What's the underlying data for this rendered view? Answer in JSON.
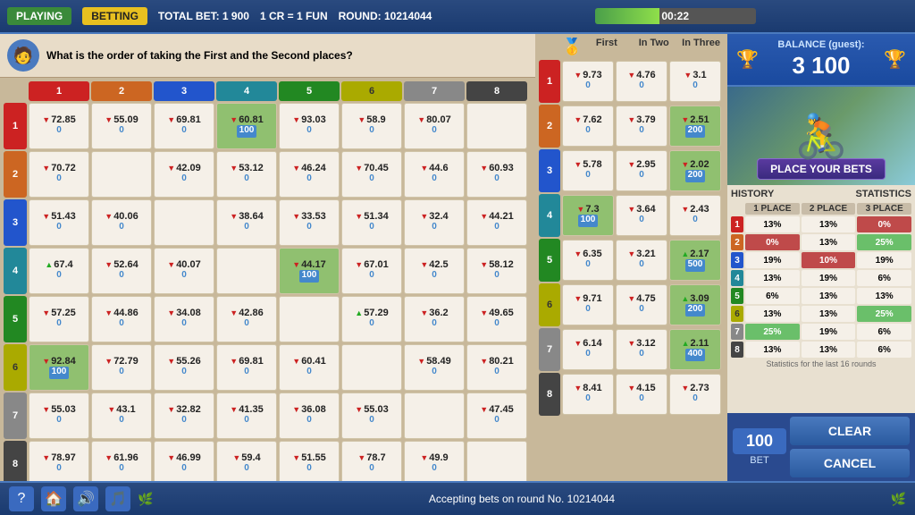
{
  "topBar": {
    "playing": "PLAYING",
    "betting": "BETTING",
    "totalBet": "TOTAL BET:  1 900",
    "crInfo": "1 CR = 1 FUN",
    "round": "ROUND:  10214044",
    "timer": "00:22",
    "timerPercent": 40
  },
  "balance": {
    "title": "BALANCE (guest):",
    "amount": "3 100"
  },
  "placeBets": "PLACE YOUR BETS",
  "question": "What is the order of taking the First and the Second places?",
  "colHeaders": [
    "1",
    "2",
    "3",
    "4",
    "5",
    "6",
    "7",
    "8"
  ],
  "rowHeaders": [
    "1",
    "2",
    "3",
    "4",
    "5",
    "6",
    "7",
    "8"
  ],
  "oddsHeaders": {
    "first": "First",
    "inTwo": "In Two",
    "inThree": "In Three"
  },
  "gridData": [
    [
      {
        "odds": "72.85",
        "bet": "0",
        "up": false
      },
      {
        "odds": "55.09",
        "bet": "0",
        "up": false
      },
      {
        "odds": "69.81",
        "bet": "0",
        "up": false
      },
      {
        "odds": "60.81",
        "bet": "100",
        "up": false,
        "hl": true
      },
      {
        "odds": "93.03",
        "bet": "0",
        "up": false
      },
      {
        "odds": "58.9",
        "bet": "0",
        "up": false
      },
      {
        "odds": "80.07",
        "bet": "0",
        "up": false
      },
      {
        "odds": "",
        "bet": "",
        "skip": true
      }
    ],
    [
      {
        "odds": "70.72",
        "bet": "0",
        "up": false
      },
      {
        "odds": "",
        "bet": "",
        "skip": true
      },
      {
        "odds": "42.09",
        "bet": "0",
        "up": false
      },
      {
        "odds": "53.12",
        "bet": "0",
        "up": false
      },
      {
        "odds": "46.24",
        "bet": "0",
        "up": false
      },
      {
        "odds": "70.45",
        "bet": "0",
        "up": false
      },
      {
        "odds": "44.6",
        "bet": "0",
        "up": false
      },
      {
        "odds": "60.93",
        "bet": "0",
        "up": false
      }
    ],
    [
      {
        "odds": "51.43",
        "bet": "0",
        "up": false
      },
      {
        "odds": "40.06",
        "bet": "0",
        "up": false
      },
      {
        "odds": "",
        "bet": "",
        "skip": true
      },
      {
        "odds": "38.64",
        "bet": "0",
        "up": false
      },
      {
        "odds": "33.53",
        "bet": "0",
        "up": false
      },
      {
        "odds": "51.34",
        "bet": "0",
        "up": false
      },
      {
        "odds": "32.4",
        "bet": "0",
        "up": false
      },
      {
        "odds": "44.21",
        "bet": "0",
        "up": false
      }
    ],
    [
      {
        "odds": "67.4",
        "bet": "0",
        "up": true
      },
      {
        "odds": "52.64",
        "bet": "0",
        "up": false
      },
      {
        "odds": "40.07",
        "bet": "0",
        "up": false
      },
      {
        "odds": "",
        "bet": "",
        "skip": true
      },
      {
        "odds": "44.17",
        "bet": "100",
        "up": false,
        "hl": true
      },
      {
        "odds": "67.01",
        "bet": "0",
        "up": false
      },
      {
        "odds": "42.5",
        "bet": "0",
        "up": false
      },
      {
        "odds": "58.12",
        "bet": "0",
        "up": false
      }
    ],
    [
      {
        "odds": "57.25",
        "bet": "0",
        "up": false
      },
      {
        "odds": "44.86",
        "bet": "0",
        "up": false
      },
      {
        "odds": "34.08",
        "bet": "0",
        "up": false
      },
      {
        "odds": "42.86",
        "bet": "0",
        "up": false
      },
      {
        "odds": "",
        "bet": "",
        "skip": true
      },
      {
        "odds": "57.29",
        "bet": "0",
        "up": true
      },
      {
        "odds": "36.2",
        "bet": "0",
        "up": false
      },
      {
        "odds": "49.65",
        "bet": "0",
        "up": false
      }
    ],
    [
      {
        "odds": "92.84",
        "bet": "100",
        "up": false,
        "hl": true
      },
      {
        "odds": "72.79",
        "bet": "0",
        "up": false
      },
      {
        "odds": "55.26",
        "bet": "0",
        "up": false
      },
      {
        "odds": "69.81",
        "bet": "0",
        "up": false
      },
      {
        "odds": "60.41",
        "bet": "0",
        "up": false
      },
      {
        "odds": "",
        "bet": "",
        "skip": true
      },
      {
        "odds": "58.49",
        "bet": "0",
        "up": false
      },
      {
        "odds": "80.21",
        "bet": "0",
        "up": false
      }
    ],
    [
      {
        "odds": "55.03",
        "bet": "0",
        "up": false
      },
      {
        "odds": "43.1",
        "bet": "0",
        "up": false
      },
      {
        "odds": "32.82",
        "bet": "0",
        "up": false
      },
      {
        "odds": "41.35",
        "bet": "0",
        "up": false
      },
      {
        "odds": "36.08",
        "bet": "0",
        "up": false
      },
      {
        "odds": "55.03",
        "bet": "0",
        "up": false
      },
      {
        "odds": "",
        "bet": "",
        "skip": true
      },
      {
        "odds": "47.45",
        "bet": "0",
        "up": false
      }
    ],
    [
      {
        "odds": "78.97",
        "bet": "0",
        "up": false
      },
      {
        "odds": "61.96",
        "bet": "0",
        "up": false
      },
      {
        "odds": "46.99",
        "bet": "0",
        "up": false
      },
      {
        "odds": "59.4",
        "bet": "0",
        "up": false
      },
      {
        "odds": "51.55",
        "bet": "0",
        "up": false
      },
      {
        "odds": "78.7",
        "bet": "0",
        "up": false
      },
      {
        "odds": "49.9",
        "bet": "0",
        "up": false
      },
      {
        "odds": "",
        "bet": "",
        "skip": true
      }
    ]
  ],
  "oddsData": [
    [
      {
        "odds": "9.73",
        "bet": "0",
        "up": false
      },
      {
        "odds": "4.76",
        "bet": "0",
        "up": false
      },
      {
        "odds": "3.1",
        "bet": "0",
        "up": false
      }
    ],
    [
      {
        "odds": "7.62",
        "bet": "0",
        "up": false
      },
      {
        "odds": "3.79",
        "bet": "0",
        "up": false
      },
      {
        "odds": "2.51",
        "bet": "200",
        "up": false,
        "hl": true
      }
    ],
    [
      {
        "odds": "5.78",
        "bet": "0",
        "up": false
      },
      {
        "odds": "2.95",
        "bet": "0",
        "up": false
      },
      {
        "odds": "2.02",
        "bet": "200",
        "up": false,
        "hl": true
      }
    ],
    [
      {
        "odds": "7.3",
        "bet": "100",
        "up": false,
        "hl": true
      },
      {
        "odds": "3.64",
        "bet": "0",
        "up": false
      },
      {
        "odds": "2.43",
        "bet": "0",
        "up": false
      }
    ],
    [
      {
        "odds": "6.35",
        "bet": "0",
        "up": false
      },
      {
        "odds": "3.21",
        "bet": "0",
        "up": false
      },
      {
        "odds": "2.17",
        "bet": "500",
        "up": true,
        "hl": true
      }
    ],
    [
      {
        "odds": "9.71",
        "bet": "0",
        "up": false
      },
      {
        "odds": "4.75",
        "bet": "0",
        "up": false
      },
      {
        "odds": "3.09",
        "bet": "200",
        "up": true,
        "hl": true
      }
    ],
    [
      {
        "odds": "6.14",
        "bet": "0",
        "up": false
      },
      {
        "odds": "3.12",
        "bet": "0",
        "up": false
      },
      {
        "odds": "2.11",
        "bet": "400",
        "up": true,
        "hl": true
      }
    ],
    [
      {
        "odds": "8.41",
        "bet": "0",
        "up": false
      },
      {
        "odds": "4.15",
        "bet": "0",
        "up": false
      },
      {
        "odds": "2.73",
        "bet": "0",
        "up": false
      }
    ]
  ],
  "historyLabel": "HISTORY",
  "statsLabel": "STATISTICS",
  "statsColHeaders": [
    "1 PLACE",
    "2 PLACE",
    "3 PLACE"
  ],
  "statsRows": [
    {
      "num": "1",
      "col": "rc1",
      "p1": "13%",
      "p2": "13%",
      "p3": "0%",
      "p3hl": "red"
    },
    {
      "num": "2",
      "col": "rc2",
      "p1": "0%",
      "p1hl": "red",
      "p2": "13%",
      "p3": "25%",
      "p3hl": "green"
    },
    {
      "num": "3",
      "col": "rc3",
      "p1": "19%",
      "p2": "10%",
      "p2hl": "red",
      "p3": "19%"
    },
    {
      "num": "4",
      "col": "rc4",
      "p1": "13%",
      "p2": "19%",
      "p3": "6%"
    },
    {
      "num": "5",
      "col": "rc5",
      "p1": "6%",
      "p2": "13%",
      "p3": "13%"
    },
    {
      "num": "6",
      "col": "rc6",
      "p1": "13%",
      "p2": "13%",
      "p3": "25%",
      "p3hl": "green"
    },
    {
      "num": "7",
      "col": "rc7",
      "p1": "25%",
      "p2": "19%",
      "p3": "6%",
      "p1hl": "green"
    },
    {
      "num": "8",
      "col": "rc8",
      "p1": "13%",
      "p2": "13%",
      "p3": "6%"
    }
  ],
  "statsFooter": "Statistics for the last 16 rounds",
  "betAmount": "100",
  "betLabel": "BET",
  "clearLabel": "CLEAR",
  "cancelLabel": "CANCEL",
  "bottomStatus": "Accepting bets on round No. 10214044"
}
